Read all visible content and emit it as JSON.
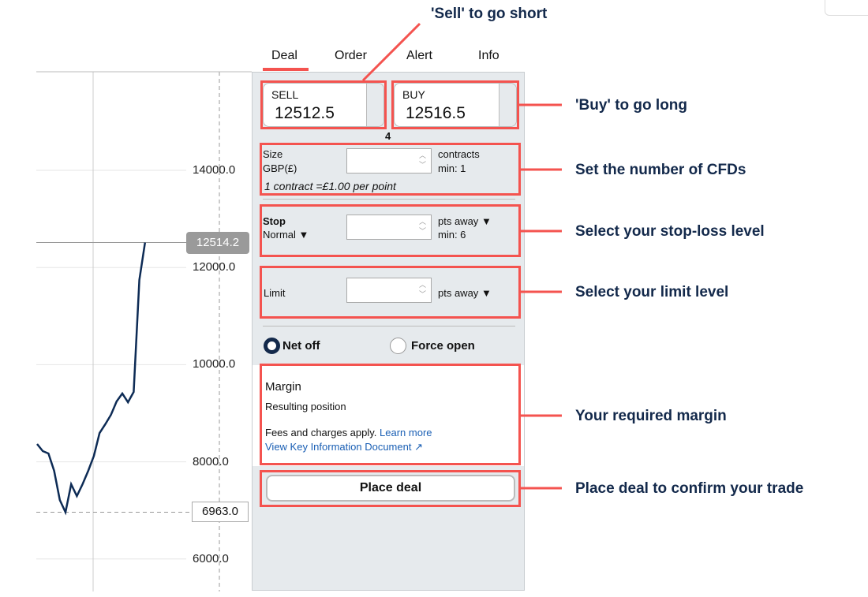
{
  "tabs": [
    "Deal",
    "Order",
    "Alert",
    "Info"
  ],
  "sell": {
    "label": "SELL",
    "price": "12512.5"
  },
  "buy": {
    "label": "BUY",
    "price": "12516.5"
  },
  "spread": "4",
  "size": {
    "label1": "Size",
    "label2": "GBP(£)",
    "unit": "contracts",
    "min": "min: 1",
    "note": "1 contract =£1.00 per point"
  },
  "stop": {
    "label": "Stop",
    "type": "Normal",
    "unit": "pts away",
    "min": "min: 6"
  },
  "limit": {
    "label": "Limit",
    "unit": "pts away"
  },
  "radio": {
    "net_off": "Net off",
    "force_open": "Force open",
    "selected": "net_off"
  },
  "margin": {
    "label": "Margin",
    "resulting": "Resulting position",
    "fees": "Fees and charges apply.",
    "learn_more": "Learn more",
    "kid": "View Key Information Document"
  },
  "place_deal": "Place deal",
  "annotations": {
    "sell": "'Sell' to go short",
    "buy": "'Buy' to go long",
    "size": "Set the number of CFDs",
    "stop": "Select your stop-loss level",
    "limit": "Select your limit level",
    "margin": "Your required margin",
    "place": "Place deal to confirm your trade"
  },
  "accent": "#f4534f",
  "chart_data": {
    "type": "line",
    "yticks": [
      "14000.0",
      "12000.0",
      "10000.0",
      "8000.0",
      "6000.0"
    ],
    "ylim": [
      5500,
      15800
    ],
    "current_label": "12514.2",
    "low_label": "6963.0",
    "line_color": "#0d2b55",
    "values": [
      8367,
      8221,
      8172,
      7815,
      7214,
      6963,
      7539,
      7295,
      7539,
      7815,
      8123,
      8594,
      8773,
      8968,
      9244,
      9406,
      9227,
      9438,
      11744,
      12514
    ]
  }
}
